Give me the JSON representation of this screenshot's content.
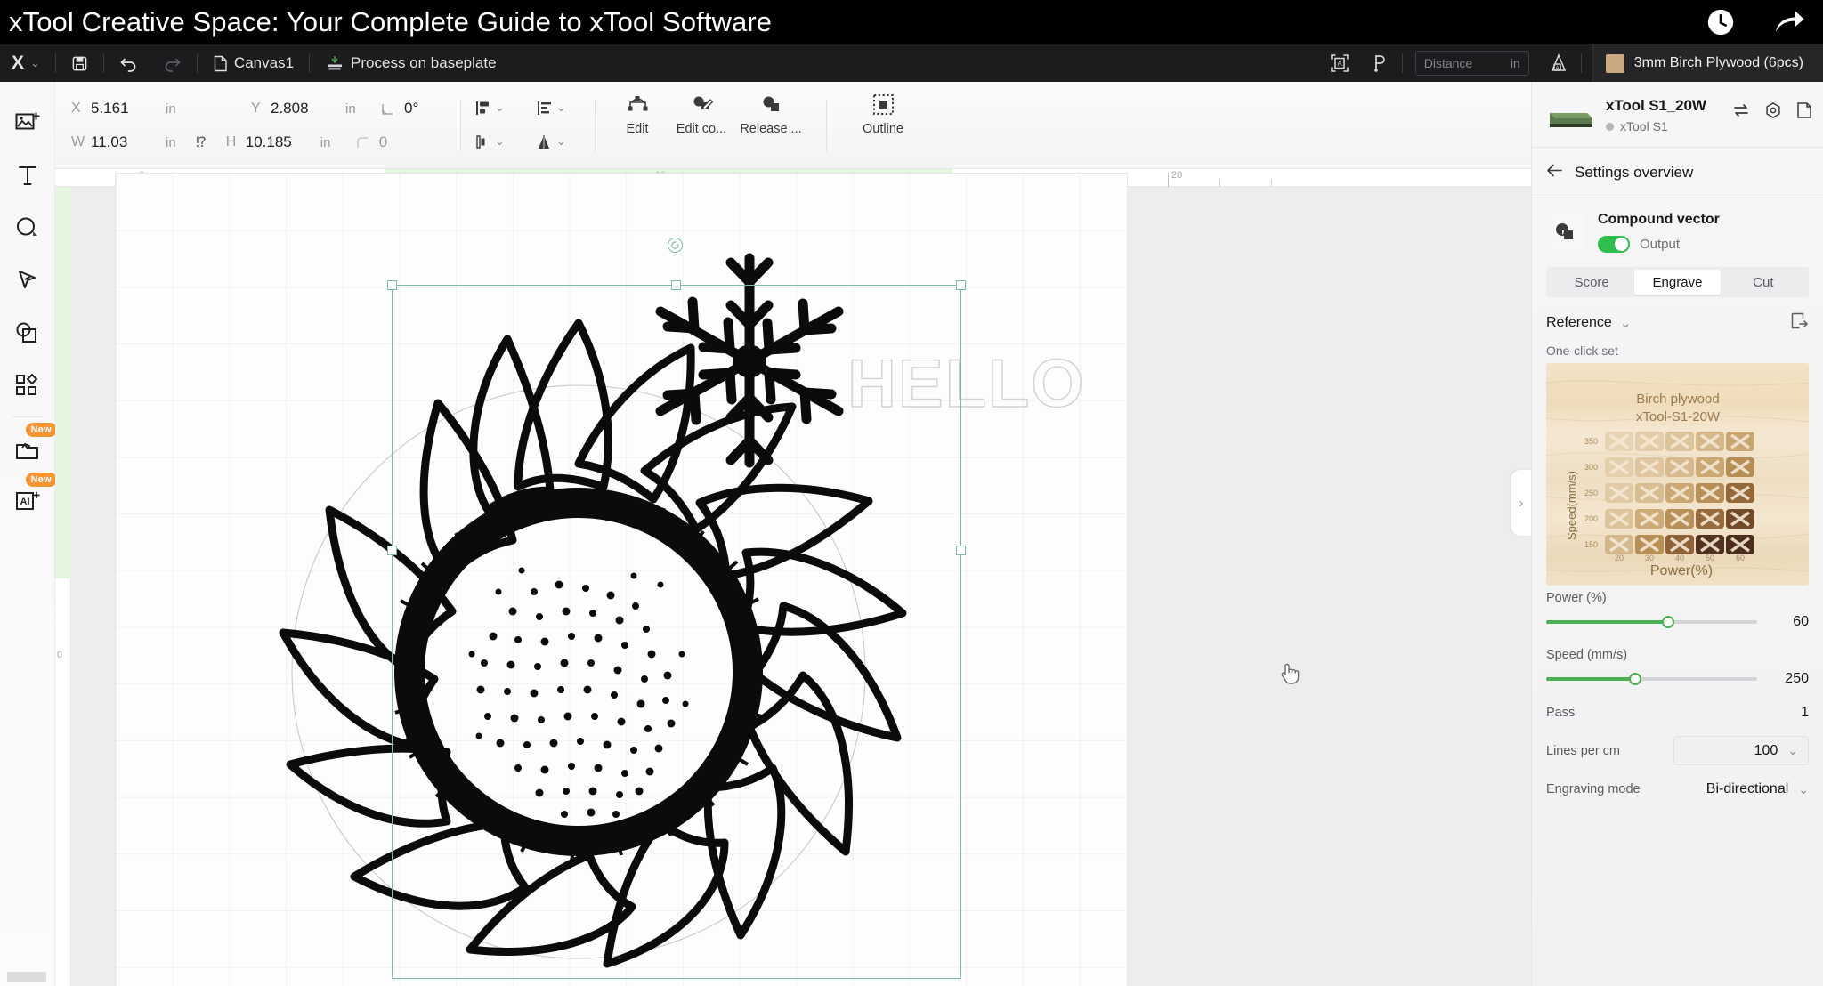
{
  "banner": {
    "title": "xTool Creative Space: Your Complete Guide to xTool Software",
    "icons": [
      {
        "name": "history-clock-icon",
        "glyph": "clock"
      },
      {
        "name": "share-arrow-icon",
        "glyph": "share"
      }
    ]
  },
  "menubar": {
    "logo": "X",
    "logo_caret": "⌄",
    "save_icon": "save-icon",
    "undo_icon": "undo-icon",
    "redo_icon": "redo-icon",
    "canvas_tab": "Canvas1",
    "process_mode": "Process on baseplate",
    "frame_icon": "frame-preview-icon",
    "measure_icon": "measure-icon",
    "distance_placeholder": "Distance",
    "distance_unit": "in",
    "calibrate_icon": "calibration-icon",
    "material": "3mm Birch Plywood (6pcs)",
    "material_color": "#c9a882"
  },
  "properties": {
    "x_label": "X",
    "x_value": "5.161",
    "x_unit": "in",
    "y_label": "Y",
    "y_value": "2.808",
    "y_unit": "in",
    "rotation_value": "0°",
    "w_label": "W",
    "w_value": "11.03",
    "w_unit": "in",
    "lock_icon": "link-unlocked-icon",
    "h_label": "H",
    "h_value": "10.185",
    "h_unit": "in",
    "radius_value": "0",
    "align_icon": "align-objects-icon",
    "distribute_icon": "distribute-icon",
    "order_icon": "arrange-order-icon",
    "flip_icon": "flip-icon",
    "actions": [
      {
        "label": "Edit",
        "icon": "node-edit-icon"
      },
      {
        "label": "Edit co...",
        "icon": "edit-contour-icon"
      },
      {
        "label": "Release ...",
        "icon": "release-compound-icon"
      },
      {
        "label": "Outline",
        "icon": "outline-icon"
      }
    ]
  },
  "toolrail": {
    "items": [
      {
        "name": "image-add-tool",
        "badge": ""
      },
      {
        "name": "text-tool",
        "badge": ""
      },
      {
        "name": "shape-tool",
        "badge": ""
      },
      {
        "name": "pen-tool",
        "badge": ""
      },
      {
        "name": "combine-shapes-tool",
        "badge": ""
      },
      {
        "name": "elements-tool",
        "badge": ""
      },
      {
        "name": "projects-tool",
        "badge": "New"
      },
      {
        "name": "ai-tool",
        "badge": "New"
      }
    ]
  },
  "canvas": {
    "ruler_h_ticks": [
      "0",
      "10",
      "20"
    ],
    "ruler_v_ticks": [
      "0"
    ],
    "artwork": [
      "sunflower-line-art",
      "snowflake-icon",
      "hello-outline-text",
      "circle-outline"
    ],
    "hello_text": "HELLO",
    "panel_toggle_icon": "chevron-right-icon"
  },
  "rightpanel": {
    "device": {
      "name": "xTool S1_20W",
      "status_label": "xTool S1",
      "status_color": "#b5b5ba",
      "actions": [
        "switch-device-icon",
        "device-settings-icon",
        "device-file-icon"
      ]
    },
    "settings": {
      "back_icon": "back-arrow-icon",
      "title": "Settings overview"
    },
    "object": {
      "icon": "compound-vector-icon",
      "name": "Compound vector",
      "output_label": "Output",
      "output_on": true,
      "toggle_color": "#2fbf4c"
    },
    "modes": [
      {
        "label": "Score",
        "active": false
      },
      {
        "label": "Engrave",
        "active": true
      },
      {
        "label": "Cut",
        "active": false
      }
    ],
    "reference": {
      "label": "Reference",
      "caret": "⌄",
      "export_icon": "save-preset-icon"
    },
    "oneclick": {
      "label": "One-click set",
      "material_title": "Birch plywood",
      "machine_title": "xTool-S1-20W",
      "y_axis_label": "Speed(mm/s)",
      "x_axis_label": "Power(%)",
      "speed_ticks": [
        "350",
        "300",
        "250",
        "200",
        "150"
      ],
      "power_ticks": [
        "20",
        "30",
        "40",
        "50",
        "60"
      ]
    },
    "params": {
      "power_label": "Power (%)",
      "power_value": "60",
      "power_pct": 58,
      "speed_label": "Speed (mm/s)",
      "speed_value": "250",
      "speed_pct": 42,
      "pass_label": "Pass",
      "pass_value": "1",
      "lines_label": "Lines per cm",
      "lines_value": "100",
      "lines_caret": "⌄",
      "mode_label": "Engraving mode",
      "mode_value": "Bi-directional",
      "mode_caret": "⌄"
    }
  }
}
